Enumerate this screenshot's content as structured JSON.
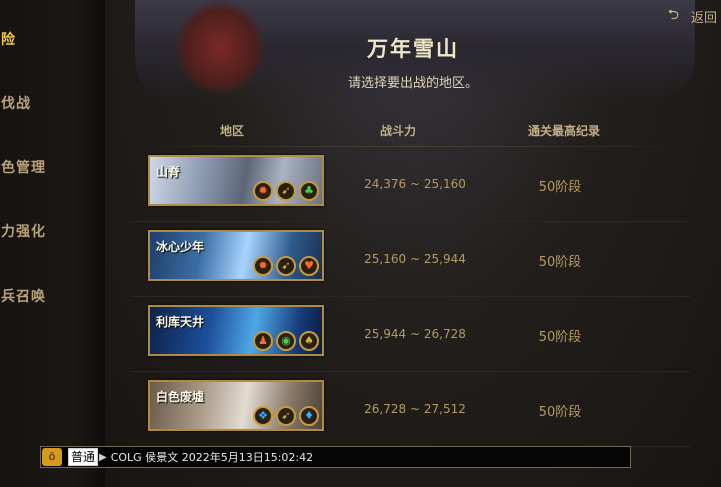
{
  "sidebar": {
    "items": [
      {
        "label": "冒险",
        "active": true
      },
      {
        "label": "讨伐战",
        "active": false
      },
      {
        "label": "角色管理",
        "active": false
      },
      {
        "label": "能力强化",
        "active": false
      },
      {
        "label": "佣兵召唤",
        "active": false
      }
    ]
  },
  "header": {
    "back_label": "返回",
    "back_icon": "return-arrow-icon",
    "title": "万年雪山",
    "subtitle": "请选择要出战的地区。"
  },
  "table": {
    "columns": [
      "地区",
      "战斗力",
      "通关最高纪录"
    ],
    "rows": [
      {
        "name": "山脊",
        "power_min": "24,376",
        "power_sep": "~",
        "power_max": "25,160",
        "record": "50阶段",
        "icons": [
          {
            "name": "fire-emblem-icon",
            "glyph": "✹",
            "tone": "red"
          },
          {
            "name": "arrow-emblem-icon",
            "glyph": "➹",
            "tone": "olive"
          },
          {
            "name": "club-emblem-icon",
            "glyph": "♣",
            "tone": "green"
          }
        ]
      },
      {
        "name": "冰心少年",
        "power_min": "25,160",
        "power_sep": "~",
        "power_max": "25,944",
        "record": "50阶段",
        "icons": [
          {
            "name": "fire-emblem-icon",
            "glyph": "✹",
            "tone": "red"
          },
          {
            "name": "arrow-emblem-icon",
            "glyph": "➹",
            "tone": "olive"
          },
          {
            "name": "heart-emblem-icon",
            "glyph": "♥",
            "tone": "red"
          }
        ]
      },
      {
        "name": "利库天井",
        "power_min": "25,944",
        "power_sep": "~",
        "power_max": "26,728",
        "record": "50阶段",
        "icons": [
          {
            "name": "figure-emblem-icon",
            "glyph": "♟",
            "tone": "red"
          },
          {
            "name": "eye-emblem-icon",
            "glyph": "◉",
            "tone": "green"
          },
          {
            "name": "spade-emblem-icon",
            "glyph": "♠",
            "tone": "olive"
          }
        ]
      },
      {
        "name": "白色废墟",
        "power_min": "26,728",
        "power_sep": "~",
        "power_max": "27,512",
        "record": "50阶段",
        "icons": [
          {
            "name": "wing-emblem-icon",
            "glyph": "❖",
            "tone": "blue"
          },
          {
            "name": "arrow-emblem-icon",
            "glyph": "➹",
            "tone": "olive"
          },
          {
            "name": "diamond-emblem-icon",
            "glyph": "♦",
            "tone": "blue"
          }
        ]
      }
    ]
  },
  "chat": {
    "channel": "普通",
    "sender": "COLG",
    "name": "侯景文",
    "timestamp": "2022年5月13日15:02:42"
  },
  "colors": {
    "active": "#f0c64a",
    "sidebar_text": "#b8a27a",
    "value_text": "#b59a62",
    "thumb_border": "#b08b44"
  }
}
